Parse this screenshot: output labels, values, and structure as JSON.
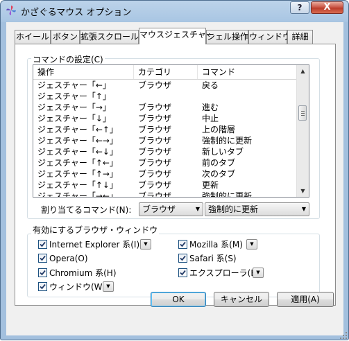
{
  "window": {
    "title": "かざぐるマウス オプション",
    "help_label": "?",
    "close_label": "X"
  },
  "tabs": [
    "ホイール",
    "ボタン",
    "拡張スクロール",
    "マウスジェスチャー",
    "シェル操作",
    "ウィンドウ",
    "詳細"
  ],
  "active_tab": 3,
  "command_settings": {
    "group_label": "コマンドの設定(C)",
    "columns": [
      "操作",
      "カテゴリ",
      "コマンド"
    ],
    "rows": [
      {
        "action": "ジェスチャー「←」",
        "category": "ブラウザ",
        "command": "戻る"
      },
      {
        "action": "ジェスチャー「↑」",
        "category": "",
        "command": ""
      },
      {
        "action": "ジェスチャー「→」",
        "category": "ブラウザ",
        "command": "進む"
      },
      {
        "action": "ジェスチャー「↓」",
        "category": "ブラウザ",
        "command": "中止"
      },
      {
        "action": "ジェスチャー「←↑」",
        "category": "ブラウザ",
        "command": "上の階層"
      },
      {
        "action": "ジェスチャー「←→」",
        "category": "ブラウザ",
        "command": "強制的に更新"
      },
      {
        "action": "ジェスチャー「←↓」",
        "category": "ブラウザ",
        "command": "新しいタブ"
      },
      {
        "action": "ジェスチャー「↑←」",
        "category": "ブラウザ",
        "command": "前のタブ"
      },
      {
        "action": "ジェスチャー「↑→」",
        "category": "ブラウザ",
        "command": "次のタブ"
      },
      {
        "action": "ジェスチャー「↑↓」",
        "category": "ブラウザ",
        "command": "更新"
      },
      {
        "action": "ジェスチャー「→←」",
        "category": "ブラウザ",
        "command": "強制的に更新"
      }
    ],
    "assign_label": "割り当てるコマンド(N):",
    "category_value": "ブラウザ",
    "command_value": "強制的に更新"
  },
  "browser_windows": {
    "group_label": "有効にするブラウザ・ウィンドウ",
    "items": [
      {
        "label": "Internet Explorer 系(I)",
        "checked": true
      },
      {
        "label": "Mozilla 系(M)",
        "checked": true
      },
      {
        "label": "Opera(O)",
        "checked": true
      },
      {
        "label": "Safari 系(S)",
        "checked": true
      },
      {
        "label": "Chromium 系(H)",
        "checked": true
      },
      {
        "label": "エクスプローラ(E)",
        "checked": true
      },
      {
        "label": "ウィンドウ(W)",
        "checked": true
      }
    ]
  },
  "buttons": {
    "ok": "OK",
    "cancel": "キャンセル",
    "apply": "適用(A)"
  },
  "colors": {
    "title_bar": "#a9c6e3",
    "close_button": "#c85040",
    "dialog_bg": "#f0f0f0"
  }
}
